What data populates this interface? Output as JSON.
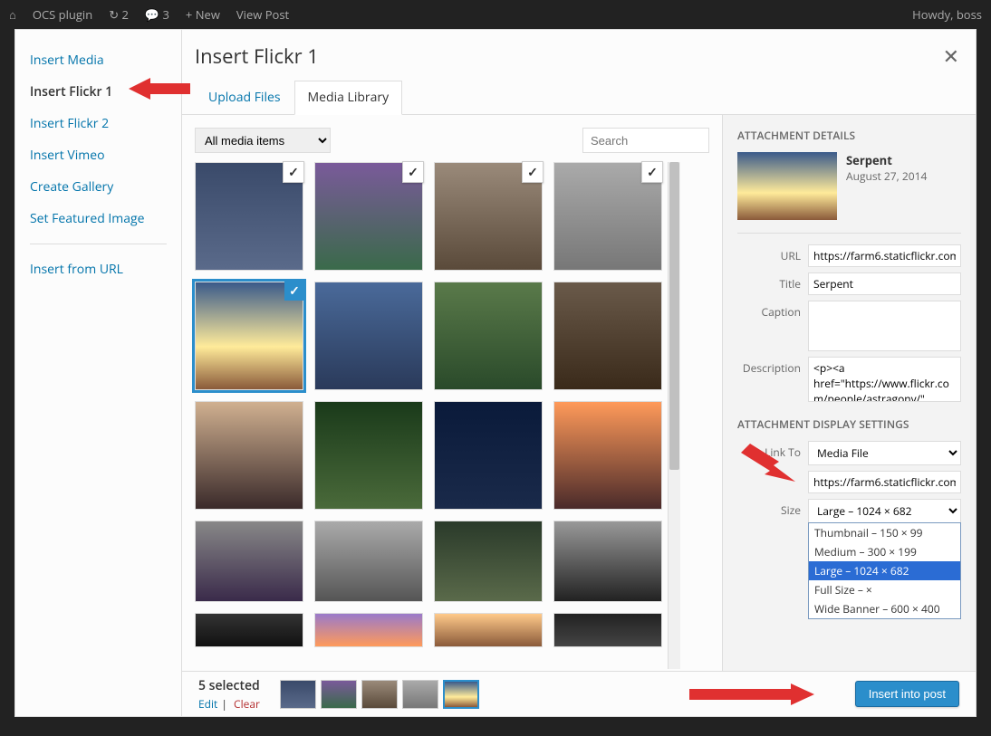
{
  "wpbar": {
    "site": "OCS plugin",
    "updates": "2",
    "comments": "3",
    "new": "+ New",
    "viewpost": "View Post",
    "howdy": "Howdy, boss"
  },
  "sidebar": {
    "items": [
      {
        "label": "Insert Media"
      },
      {
        "label": "Insert Flickr 1",
        "active": true
      },
      {
        "label": "Insert Flickr 2"
      },
      {
        "label": "Insert Vimeo"
      },
      {
        "label": "Create Gallery"
      },
      {
        "label": "Set Featured Image"
      }
    ],
    "insert_from_url": "Insert from URL"
  },
  "header": {
    "title": "Insert Flickr 1",
    "tabs": [
      {
        "label": "Upload Files"
      },
      {
        "label": "Media Library",
        "active": true
      }
    ]
  },
  "toolbar": {
    "filter": "All media items",
    "search_placeholder": "Search"
  },
  "details": {
    "section_title": "ATTACHMENT DETAILS",
    "name": "Serpent",
    "date": "August 27, 2014",
    "fields": {
      "url_label": "URL",
      "url_value": "https://farm6.staticflickr.com",
      "title_label": "Title",
      "title_value": "Serpent",
      "caption_label": "Caption",
      "caption_value": "",
      "desc_label": "Description",
      "desc_value": "<p><a href=\"https://www.flickr.com/people/astragony/\""
    },
    "display_title": "ATTACHMENT DISPLAY SETTINGS",
    "linkto_label": "Link To",
    "linkto_value": "Media File",
    "linkto_url": "https://farm6.staticflickr.com",
    "size_label": "Size",
    "size_value": "Large – 1024 × 682",
    "size_options": [
      "Thumbnail – 150 × 99",
      "Medium – 300 × 199",
      "Large – 1024 × 682",
      "Full Size – ×",
      "Wide Banner – 600 × 400"
    ]
  },
  "footer": {
    "selected": "5 selected",
    "edit": "Edit",
    "clear": "Clear",
    "insert": "Insert into post"
  }
}
